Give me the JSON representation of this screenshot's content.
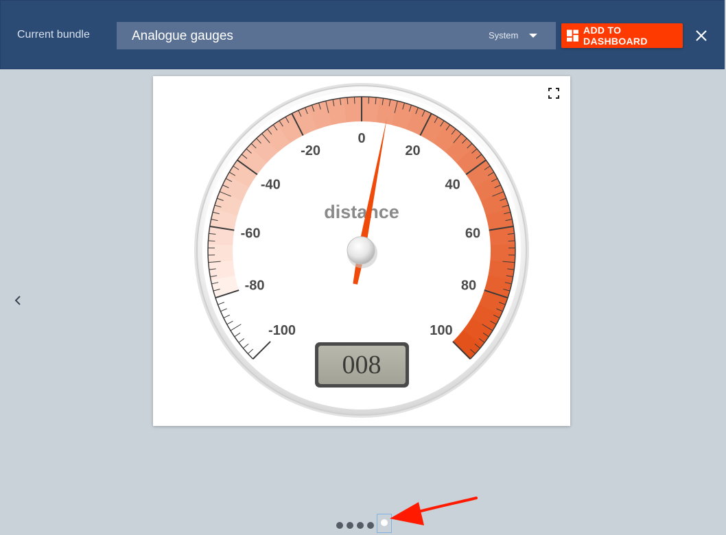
{
  "header": {
    "bundle_label": "Current bundle",
    "bundle_name": "Analogue gauges",
    "bundle_type": "System",
    "add_button_label": "ADD TO DASHBOARD",
    "accent_color": "#ff3a00",
    "background_color": "#2b4b75"
  },
  "gauge": {
    "title": "distance",
    "readout": "008",
    "value": 8,
    "min": -100,
    "max": 100,
    "major_ticks": [
      "-100",
      "-80",
      "-60",
      "-40",
      "-20",
      "0",
      "20",
      "40",
      "60",
      "80",
      "100"
    ],
    "colors": {
      "needle": "#f04a0a",
      "band_start": "#fff0ea",
      "band_end": "#e4521b"
    }
  },
  "icons": {
    "prev": "chevron-left-icon",
    "close": "close-icon",
    "fullscreen": "fullscreen-icon",
    "dashboard": "dashboard-icon",
    "dropdown": "caret-down-icon"
  },
  "pagination": {
    "total": 5,
    "active_index": 4
  }
}
